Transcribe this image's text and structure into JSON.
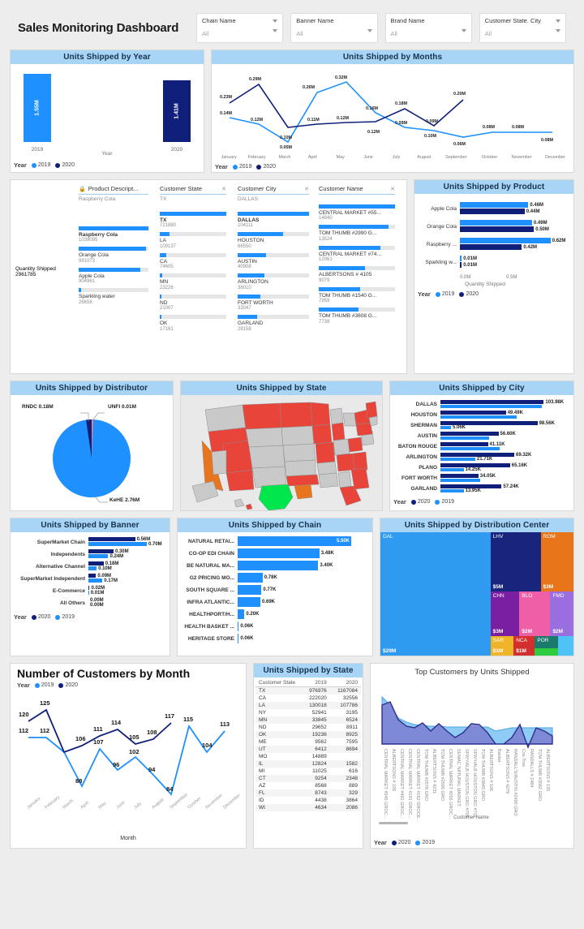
{
  "header": {
    "title": "Sales Monitoring Dashboard",
    "slicers": [
      {
        "label": "Chain Name",
        "value": "All"
      },
      {
        "label": "Banner Name",
        "value": "All"
      },
      {
        "label": "Brand Name",
        "value": "All"
      },
      {
        "label": "Customer State. City",
        "value": "All"
      }
    ]
  },
  "colors": {
    "blue_2019": "#1e90ff",
    "navy_2020": "#10207a",
    "header_band": "#a8d4f5",
    "page_bg": "#ededed"
  },
  "legend": {
    "year_label": "Year",
    "y2019": "2019",
    "y2020": "2020"
  },
  "units_by_year": {
    "title": "Units Shipped by Year",
    "axis_label": "Year",
    "chart_data": {
      "type": "bar",
      "title": "Units Shipped by Year",
      "categories": [
        "2019",
        "2020"
      ],
      "values": [
        1.55,
        1.41
      ],
      "data_labels": [
        "1.55M",
        "1.41M"
      ],
      "xlabel": "Year",
      "ylabel": "",
      "series": [
        {
          "name": "2019",
          "values": [
            1.55,
            null
          ],
          "color": "#1e90ff"
        },
        {
          "name": "2020",
          "values": [
            null,
            1.41
          ],
          "color": "#10207a"
        }
      ]
    }
  },
  "units_by_months": {
    "title": "Units Shipped by Months",
    "chart_data": {
      "type": "line",
      "title": "Units Shipped by Months",
      "categories": [
        "January",
        "February",
        "March",
        "April",
        "May",
        "June",
        "July",
        "August",
        "September",
        "October",
        "November",
        "December"
      ],
      "xlabel": "",
      "ylabel": "",
      "series": [
        {
          "name": "2019",
          "color": "#1e90ff",
          "values": [
            0.14,
            0.12,
            0.05,
            0.26,
            0.32,
            0.16,
            0.09,
            0.1,
            0.06,
            0.08,
            0.08,
            0.08
          ],
          "labels": [
            "0.14M",
            "0.12M",
            "0.05M",
            "0.26M",
            "0.32M",
            "0.16M",
            "0.09M",
            "0.10M",
            "0.06M",
            "0.08M",
            "0.08M",
            "0.08M"
          ]
        },
        {
          "name": "2020",
          "color": "#10207a",
          "values": [
            0.23,
            0.29,
            0.1,
            0.11,
            0.12,
            0.12,
            0.18,
            0.09,
            0.2,
            null,
            null,
            null
          ],
          "labels": [
            "0.23M",
            "0.29M",
            "0.10M",
            "0.11M",
            "0.12M",
            "0.12M",
            "0.18M",
            "0.09M",
            "0.20M",
            "",
            "",
            ""
          ]
        }
      ]
    }
  },
  "decomposition_tree": {
    "columns": [
      {
        "header": "Product Descript...",
        "sub": "Raspberry Cola",
        "locked": true,
        "closable": false
      },
      {
        "header": "Customer State",
        "sub": "TX",
        "locked": false,
        "closable": true
      },
      {
        "header": "Customer City",
        "sub": "DALLAS",
        "locked": false,
        "closable": true
      },
      {
        "header": "Customer Name",
        "sub": "",
        "locked": false,
        "closable": true
      }
    ],
    "root": {
      "name": "Quantity Shipped",
      "value": "2961785"
    },
    "level_product": [
      {
        "name": "Raspberry Cola",
        "value": "1039095",
        "pct": 100,
        "selected": true
      },
      {
        "name": "Orange Cola",
        "value": "991073",
        "pct": 96,
        "selected": false
      },
      {
        "name": "Apple Cola",
        "value": "904961",
        "pct": 88,
        "selected": false
      },
      {
        "name": "Sparkling water",
        "value": "26656",
        "pct": 3,
        "selected": false
      }
    ],
    "level_state": [
      {
        "name": "TX",
        "value": "721880",
        "pct": 100,
        "selected": true
      },
      {
        "name": "LA",
        "value": "109137",
        "pct": 15,
        "selected": false
      },
      {
        "name": "CA",
        "value": "74605",
        "pct": 10,
        "selected": false
      },
      {
        "name": "MN",
        "value": "23226",
        "pct": 4,
        "selected": false
      },
      {
        "name": "ND",
        "value": "21007",
        "pct": 3,
        "selected": false
      },
      {
        "name": "OK",
        "value": "17161",
        "pct": 3,
        "selected": false
      }
    ],
    "level_city": [
      {
        "name": "DALLAS",
        "value": "104111",
        "pct": 100,
        "selected": true
      },
      {
        "name": "HOUSTON",
        "value": "66550",
        "pct": 64,
        "selected": false
      },
      {
        "name": "AUSTIN",
        "value": "40908",
        "pct": 40,
        "selected": false
      },
      {
        "name": "ARLINGTON",
        "value": "38010",
        "pct": 37,
        "selected": false
      },
      {
        "name": "FORT WORTH",
        "value": "33047",
        "pct": 32,
        "selected": false
      },
      {
        "name": "GARLAND",
        "value": "28158",
        "pct": 27,
        "selected": false
      }
    ],
    "level_name": [
      {
        "name": "CENTRAL MARKET #55...",
        "value": "14840",
        "pct": 100
      },
      {
        "name": "TOM THUMB #2990 G...",
        "value": "13524",
        "pct": 91
      },
      {
        "name": "CENTRAL MARKET #74...",
        "value": "12061",
        "pct": 81
      },
      {
        "name": "ALBERTSONS # 4105",
        "value": "9079",
        "pct": 61
      },
      {
        "name": "TOM THUMB #1540 G...",
        "value": "7959",
        "pct": 54
      },
      {
        "name": "TOM THUMB #3608 G...",
        "value": "7738",
        "pct": 52
      }
    ]
  },
  "units_by_product": {
    "title": "Units Shipped by Product",
    "chart_data": {
      "type": "bar",
      "orientation": "horizontal",
      "title": "Units Shipped by Product",
      "categories": [
        "Apple Cola",
        "Orange Cola",
        "Raspberry ...",
        "Sparkling w..."
      ],
      "xlabel": "Quantity Shipped",
      "ylabel": "",
      "xticks": [
        "0.0M",
        "0.5M"
      ],
      "series": [
        {
          "name": "2019",
          "color": "#1e90ff",
          "values": [
            0.46,
            0.49,
            0.62,
            0.01
          ],
          "labels": [
            "0.46M",
            "0.49M",
            "0.62M",
            "0.01M"
          ]
        },
        {
          "name": "2020",
          "color": "#10207a",
          "values": [
            0.44,
            0.5,
            0.42,
            0.01
          ],
          "labels": [
            "0.44M",
            "0.50M",
            "0.42M",
            "0.01M"
          ]
        }
      ]
    }
  },
  "units_by_distributor": {
    "title": "Units Shipped by Distributor",
    "chart_data": {
      "type": "pie",
      "title": "Units Shipped by Distributor",
      "labels": [
        "KeHE",
        "RNDC",
        "UNFI"
      ],
      "values": [
        2.76,
        0.18,
        0.01
      ],
      "data_labels": [
        "KeHE 2.76M",
        "RNDC 0.18M",
        "UNFI 0.01M"
      ],
      "colors": [
        "#1e90ff",
        "#10207a",
        "#f08080"
      ]
    }
  },
  "units_by_state_map": {
    "title": "Units Shipped by State",
    "chart_data": {
      "type": "map",
      "title": "Units Shipped by State",
      "highlight": {
        "TX": "#00e64d",
        "LA": "#e8741e",
        "CA": "#e8741e",
        "default_active": "#e8443a",
        "inactive": "#c9c9c9"
      }
    }
  },
  "units_by_city": {
    "title": "Units Shipped by City",
    "chart_data": {
      "type": "bar",
      "orientation": "horizontal",
      "title": "Units Shipped by City",
      "categories": [
        "DALLAS",
        "HOUSTON",
        "SHERMAN",
        "AUSTIN",
        "BATON ROUGE",
        "ARLINGTON",
        "PLANO",
        "FORT WORTH",
        "GARLAND"
      ],
      "series": [
        {
          "name": "2020",
          "color": "#10207a",
          "values": [
            103.98,
            49.49,
            98.56,
            56.6,
            41.11,
            69.32,
            65.16,
            34.05,
            57.24
          ],
          "labels": [
            "103.98K",
            "49.49K",
            "98.56K",
            "56.60K",
            "41.11K",
            "69.32K",
            "65.16K",
            "34.05K",
            "57.24K"
          ]
        },
        {
          "name": "2019",
          "color": "#1e90ff",
          "values": [
            103.98,
            49.49,
            5.06,
            56.6,
            41.11,
            21.71,
            14.25,
            34.05,
            13.95
          ],
          "labels": [
            "",
            "",
            "5.06K",
            "",
            "",
            "21.71K",
            "14.25K",
            "",
            "13.95K"
          ]
        }
      ]
    }
  },
  "units_by_banner": {
    "title": "Units Shipped by Banner",
    "chart_data": {
      "type": "bar",
      "orientation": "horizontal",
      "title": "Units Shipped by Banner",
      "categories": [
        "SuperMarket Chain",
        "Independents",
        "Alternative Channel",
        "SuperMarket Independent",
        "E-Commerce",
        "All Others"
      ],
      "series": [
        {
          "name": "2020",
          "color": "#10207a",
          "values": [
            0.56,
            0.3,
            0.18,
            0.09,
            0.02,
            0.0
          ],
          "labels": [
            "0.56M",
            "0.30M",
            "0.18M",
            "0.09M",
            "0.02M",
            "0.00M"
          ]
        },
        {
          "name": "2019",
          "color": "#1e90ff",
          "values": [
            0.7,
            0.24,
            0.1,
            0.17,
            0.01,
            0.0
          ],
          "labels": [
            "0.70M",
            "0.24M",
            "0.10M",
            "0.17M",
            "0.01M",
            "0.00M"
          ]
        }
      ]
    }
  },
  "units_by_chain": {
    "title": "Units Shipped by Chain",
    "chart_data": {
      "type": "bar",
      "orientation": "horizontal",
      "title": "Units Shipped by Chain",
      "categories": [
        "NATURAL RETAI...",
        "CO-OP EDI CHAIN",
        "BE NATURAL MA...",
        "G2 PRICING MO...",
        "SOUTH SQUARE ...",
        "INFRA ATLANTIC...",
        "HEALTHPORT/H...",
        "HEALTH BASKET ...",
        "HERITAGE STORE"
      ],
      "values": [
        5.5,
        3.48,
        3.4,
        0.78,
        0.77,
        0.69,
        0.2,
        0.06,
        0.06
      ],
      "data_labels": [
        "5.50K",
        "3.48K",
        "3.40K",
        "0.78K",
        "0.77K",
        "0.69K",
        "0.20K",
        "0.06K",
        "0.06K"
      ],
      "color": "#1e90ff"
    }
  },
  "units_by_dc": {
    "title": "Units Shipped by Distribution Center",
    "chart_data": {
      "type": "treemap",
      "title": "Units Shipped by Distribution Center",
      "nodes": [
        {
          "label": "DAL",
          "value": "$29M",
          "color": "#2e9bf0"
        },
        {
          "label": "LHV",
          "value": "$5M",
          "color": "#17257d"
        },
        {
          "label": "ROM",
          "value": "$3M",
          "color": "#e8751a"
        },
        {
          "label": "CHN",
          "value": "$3M",
          "color": "#7b1fa2"
        },
        {
          "label": "BLO",
          "value": "$2M",
          "color": "#ef5fa7"
        },
        {
          "label": "FMD",
          "value": "$2M",
          "color": "#9b6ee0"
        },
        {
          "label": "SAR",
          "value": "$1M",
          "color": "#f0b429"
        },
        {
          "label": "NCA",
          "value": "$1M",
          "color": "#d32f2f"
        },
        {
          "label": "POR",
          "value": "",
          "color": "#1a7a6c"
        },
        {
          "label": "",
          "value": "",
          "color": "#4fc3f7"
        },
        {
          "label": "",
          "value": "",
          "color": "#2ecc40"
        }
      ]
    }
  },
  "customers_by_month": {
    "title": "Number of Customers by Month",
    "axis_label": "Month",
    "chart_data": {
      "type": "line",
      "title": "Number of Customers by Month",
      "categories": [
        "January",
        "February",
        "March",
        "April",
        "May",
        "June",
        "July",
        "August",
        "September",
        "October",
        "November",
        "December"
      ],
      "xlabel": "Month",
      "ylabel": "",
      "series": [
        {
          "name": "2019",
          "color": "#1e90ff",
          "values": [
            112,
            112,
            104,
            88,
            107,
            96,
            102,
            94,
            84,
            115,
            104,
            113
          ],
          "labels": [
            "112",
            "112",
            "",
            "88",
            "107",
            "96",
            "102",
            "94",
            "84",
            "115",
            "104",
            "113"
          ]
        },
        {
          "name": "2020",
          "color": "#10207a",
          "values": [
            120,
            125,
            104,
            106,
            111,
            114,
            105,
            108,
            117,
            null,
            null,
            null
          ],
          "labels": [
            "120",
            "125",
            "",
            "106",
            "111",
            "114",
            "105",
            "108",
            "117",
            "",
            "",
            ""
          ]
        }
      ]
    }
  },
  "state_table": {
    "title": "Units Shipped by State",
    "chart_data": {
      "type": "table",
      "title": "Units Shipped by State",
      "columns": [
        "Customer State",
        "2019",
        "2020"
      ],
      "rows": [
        [
          "TX",
          "976976",
          "1167084"
        ],
        [
          "CA",
          "222020",
          "32556"
        ],
        [
          "LA",
          "130018",
          "107786"
        ],
        [
          "NY",
          "52941",
          "3195"
        ],
        [
          "MN",
          "33845",
          "6524"
        ],
        [
          "ND",
          "29652",
          "8911"
        ],
        [
          "OK",
          "19236",
          "8925"
        ],
        [
          "ME",
          "9562",
          "7595"
        ],
        [
          "UT",
          "6412",
          "8694"
        ],
        [
          "MO",
          "14889",
          ""
        ],
        [
          "IL",
          "12824",
          "1582"
        ],
        [
          "MI",
          "11025",
          "616"
        ],
        [
          "CT",
          "9254",
          "2348"
        ],
        [
          "AZ",
          "8568",
          "889"
        ],
        [
          "FL",
          "8743",
          "329"
        ],
        [
          "ID",
          "4438",
          "3864"
        ],
        [
          "WI",
          "4634",
          "2086"
        ]
      ]
    }
  },
  "top_customers": {
    "title": "Top Customers by Units Shipped",
    "axis_label": "Customer Name",
    "chart_data": {
      "type": "area",
      "title": "Top Customers by Units Shipped",
      "xlabel": "Customer Name",
      "categories": [
        "CENTRAL MARKET #545 GROC...",
        "ALBERTSONS # 226",
        "CENTRAL MARKET #491 GROC...",
        "CENTRAL MARKET #191 GROC...",
        "CENTRAL MARKET #162 GROCE...",
        "TOM THUMB #2578 GRO",
        "ALBERTSONS # 4231",
        "TOM THUMB #2595 GRO",
        "CENTRAL MARKET #055 GROC...",
        "SUMAC NATURAL MARKET",
        "SFWY/ALB HOUSTON GRO #709",
        "SFWY/ALB HOUSTON GRO #719",
        "TOM THUMB #3845 GRO",
        "ALBERTSONS # 106",
        "Bardot",
        "ALBERTSONS # 4279",
        "RANDALL'S/AUSTIN #2490 GRO",
        "Cos Trse",
        "RANDALLS # 2484",
        "TOM THUMB #3582 GRO",
        "ALBERTSONS # 135"
      ],
      "series": [
        {
          "name": "2019",
          "color": "#6bb9f0",
          "values": [
            100,
            78,
            52,
            44,
            41,
            40,
            39,
            39,
            38,
            38,
            38,
            38,
            38,
            38,
            0,
            37,
            37,
            37,
            37,
            37,
            37
          ]
        },
        {
          "name": "2020",
          "color": "#2b2f8f",
          "values": [
            88,
            90,
            48,
            38,
            36,
            41,
            33,
            40,
            33,
            26,
            31,
            40,
            39,
            31,
            0,
            22,
            40,
            18,
            35,
            33,
            28
          ]
        }
      ]
    }
  }
}
